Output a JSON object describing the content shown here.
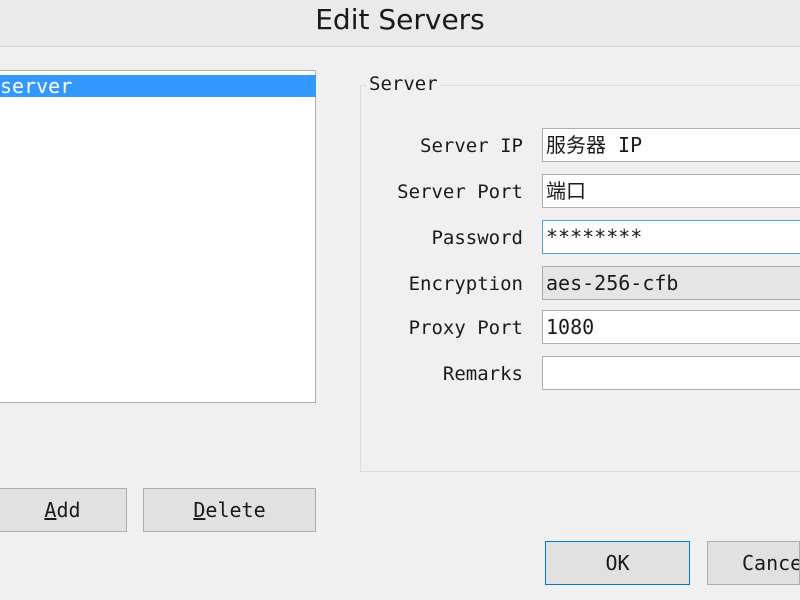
{
  "window": {
    "title": "Edit Servers"
  },
  "server_list": {
    "items": [
      {
        "label": "server",
        "selected": true
      }
    ]
  },
  "server_group": {
    "title": "Server",
    "fields": {
      "server_ip": {
        "label": "Server IP",
        "value": "服务器 IP"
      },
      "server_port": {
        "label": "Server Port",
        "value": "端口"
      },
      "password": {
        "label": "Password",
        "value": "********"
      },
      "encryption": {
        "label": "Encryption",
        "value": "aes-256-cfb"
      },
      "proxy_port": {
        "label": "Proxy Port",
        "value": "1080"
      },
      "remarks": {
        "label": "Remarks",
        "value": ""
      }
    }
  },
  "buttons": {
    "add": {
      "mnemonic": "A",
      "rest": "dd"
    },
    "delete": {
      "mnemonic": "D",
      "rest": "elete"
    },
    "ok": "OK",
    "cancel": "Cancel"
  },
  "colors": {
    "selection": "#3399ff",
    "focus_border": "#569de5",
    "default_button_border": "#0078d7"
  }
}
